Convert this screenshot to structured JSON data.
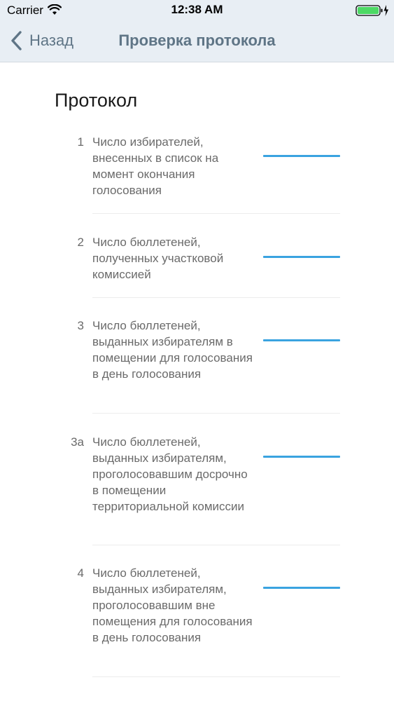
{
  "status_bar": {
    "carrier": "Carrier",
    "time": "12:38 AM"
  },
  "nav": {
    "back_label": "Назад",
    "title": "Проверка протокола"
  },
  "section": {
    "title": "Протокол"
  },
  "rows": [
    {
      "number": "1",
      "label": "Число избирателей, внесенных в список на момент окончания голосования",
      "value": ""
    },
    {
      "number": "2",
      "label": "Число бюллетеней, полученных участковой комиссией",
      "value": ""
    },
    {
      "number": "3",
      "label": "Число бюллетеней, выданных избирателям в помещении для голосования в день голосования",
      "value": ""
    },
    {
      "number": "3а",
      "label": "Число бюллетеней, выданных избирателям, проголосовавшим досрочно в помещении территориальной комиссии",
      "value": ""
    },
    {
      "number": "4",
      "label": "Число бюллетеней, выданных избирателям, проголосовавшим вне помещения для голосования в день голосования",
      "value": ""
    }
  ]
}
